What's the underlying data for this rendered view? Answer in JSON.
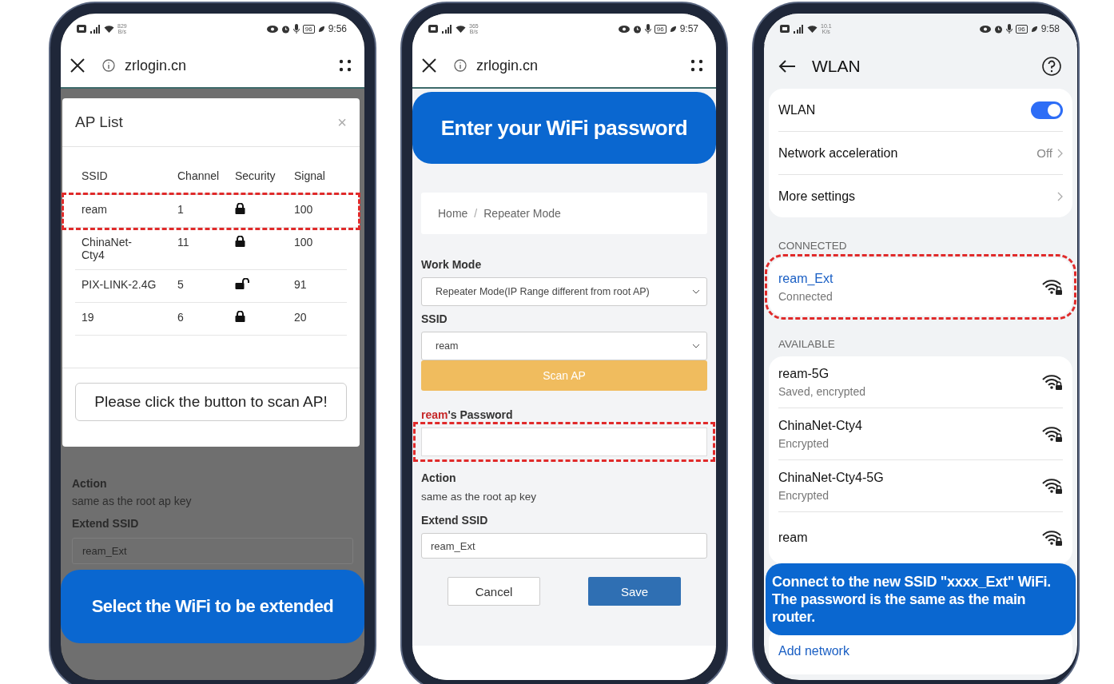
{
  "screens": [
    {
      "kind": "ap_list",
      "status_bar": {
        "speed": "829",
        "speed_unit": "B/s",
        "battery": "96",
        "time": "9:56"
      },
      "url": "zrlogin.cn",
      "modal": {
        "title": "AP List",
        "close": "×",
        "columns": [
          "SSID",
          "Channel",
          "Security",
          "Signal"
        ],
        "rows": [
          {
            "ssid": "ream",
            "channel": "1",
            "locked": true,
            "signal": "100",
            "highlighted": true
          },
          {
            "ssid": "ChinaNet-\nCty4",
            "channel": "11",
            "locked": true,
            "signal": "100",
            "highlighted": false
          },
          {
            "ssid": "PIX-LINK-2.4G",
            "channel": "5",
            "locked": false,
            "signal": "91",
            "highlighted": false
          },
          {
            "ssid": "19",
            "channel": "6",
            "locked": true,
            "signal": "20",
            "highlighted": false
          }
        ],
        "scan_button": "Please click the button to scan AP!"
      },
      "page": {
        "action_label": "Action",
        "action_text": "same as the root ap key",
        "extend_label": "Extend SSID",
        "extend_value": "ream_Ext"
      },
      "callout": "Select the WiFi to be extended"
    },
    {
      "kind": "repeater_form",
      "status_bar": {
        "speed": "365",
        "speed_unit": "B/s",
        "battery": "96",
        "time": "9:57"
      },
      "url": "zrlogin.cn",
      "callout": "Enter your WiFi password",
      "breadcrumb": [
        "Home",
        "/",
        "Repeater Mode"
      ],
      "work_mode_label": "Work Mode",
      "work_mode_value": "Repeater Mode(IP Range different from root AP)",
      "ssid_label": "SSID",
      "ssid_value": "ream",
      "scan_button": "Scan AP",
      "password_ssid": "ream",
      "password_label": "'s Password",
      "password_highlighted": true,
      "action_label": "Action",
      "action_text": "same as the root ap key",
      "extend_label": "Extend SSID",
      "extend_value": "ream_Ext",
      "buttons": [
        "Cancel",
        "Save"
      ]
    },
    {
      "kind": "wlan_settings",
      "status_bar": {
        "speed": "10.1",
        "speed_unit": "K/s",
        "battery": "96",
        "time": "9:58"
      },
      "title": "WLAN",
      "settings": [
        {
          "kind": "toggle",
          "label": "WLAN",
          "on": true
        },
        {
          "kind": "link",
          "label": "Network acceleration",
          "value": "Off"
        },
        {
          "kind": "link",
          "label": "More settings"
        }
      ],
      "connected_header": "CONNECTED",
      "connected": {
        "name": "ream_Ext",
        "status": "Connected",
        "highlighted": true
      },
      "available_header": "AVAILABLE",
      "available": [
        {
          "name": "ream-5G",
          "status": "Saved, encrypted"
        },
        {
          "name": "ChinaNet-Cty4",
          "status": "Encrypted"
        },
        {
          "name": "ChinaNet-Cty4-5G",
          "status": "Encrypted"
        },
        {
          "name": "ream"
        }
      ],
      "callout": "Connect to the new SSID \"xxxx_Ext\" WiFi. The password is the same as the main router.",
      "add_network": "Add network"
    }
  ]
}
